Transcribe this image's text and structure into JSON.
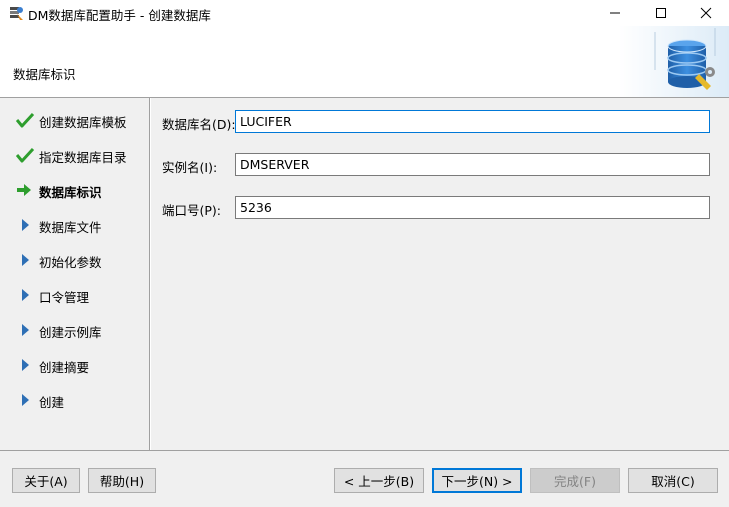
{
  "window": {
    "title": "DM数据库配置助手 - 创建数据库"
  },
  "header": {
    "title": "数据库标识"
  },
  "steps": [
    {
      "label": "创建数据库模板",
      "state": "done"
    },
    {
      "label": "指定数据库目录",
      "state": "done"
    },
    {
      "label": "数据库标识",
      "state": "current"
    },
    {
      "label": "数据库文件",
      "state": "pending"
    },
    {
      "label": "初始化参数",
      "state": "pending"
    },
    {
      "label": "口令管理",
      "state": "pending"
    },
    {
      "label": "创建示例库",
      "state": "pending"
    },
    {
      "label": "创建摘要",
      "state": "pending"
    },
    {
      "label": "创建",
      "state": "pending"
    }
  ],
  "form": {
    "db_name_label": "数据库名(D):",
    "db_name_value": "LUCIFER",
    "instance_label": "实例名(I):",
    "instance_value": "DMSERVER",
    "port_label": "端口号(P):",
    "port_value": "5236"
  },
  "footer": {
    "about_label": "关于(A)",
    "help_label": "帮助(H)",
    "prev_label": "< 上一步(B)",
    "next_label": "下一步(N) >",
    "finish_label": "完成(F)",
    "cancel_label": "取消(C)"
  },
  "colors": {
    "check": "#2e9e2e",
    "arrow_current": "#2e9e2e",
    "arrow_pending": "#2e6fb5",
    "focus": "#0078d7"
  }
}
